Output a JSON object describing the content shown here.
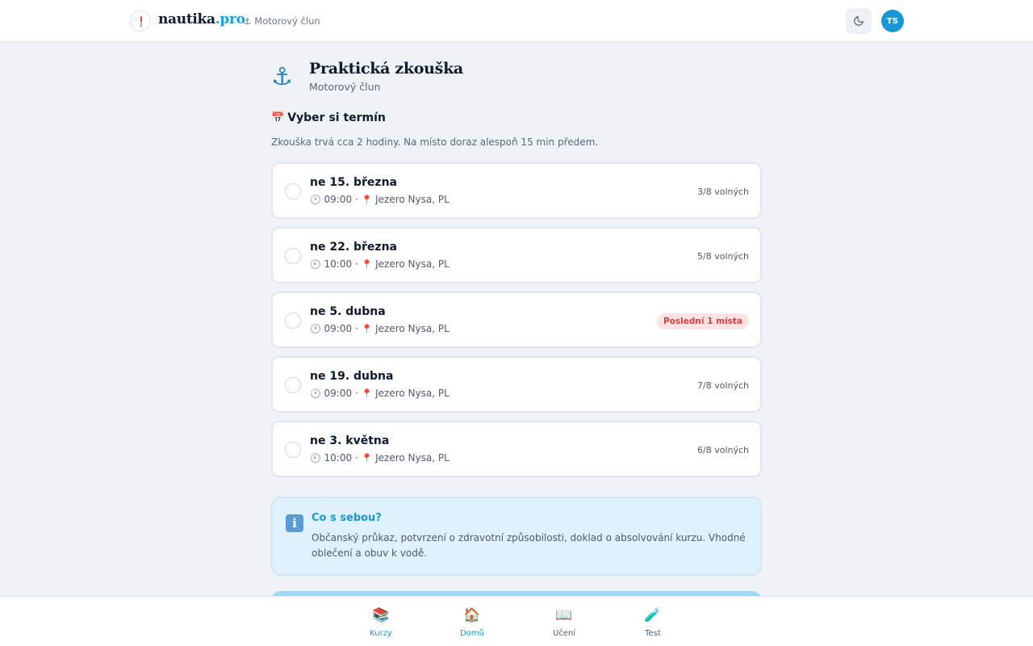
{
  "header": {
    "brand_main": "nautika",
    "brand_tld": ".pro",
    "breadcrumb": "· ⚓ Motorový člun",
    "avatar_initials": "TS",
    "theme_icon": "moon-icon"
  },
  "page": {
    "icon": "anchor-icon",
    "title": "Praktická zkouška",
    "subtitle": "Motorový člun",
    "section_icon": "📅",
    "section_title": "Vyber si termín",
    "intro": "Zkouška trvá cca 2 hodiny. Na místo doraz alespoň 15 min předem."
  },
  "slots": [
    {
      "date": "ne 15. března",
      "time": "09:00",
      "place": "Jezero Nysa, PL",
      "availability": "3/8 volných",
      "badge": ""
    },
    {
      "date": "ne 22. března",
      "time": "10:00",
      "place": "Jezero Nysa, PL",
      "availability": "5/8 volných",
      "badge": ""
    },
    {
      "date": "ne 5. dubna",
      "time": "09:00",
      "place": "Jezero Nysa, PL",
      "availability": "",
      "badge": "Poslední 1 místa"
    },
    {
      "date": "ne 19. dubna",
      "time": "09:00",
      "place": "Jezero Nysa, PL",
      "availability": "7/8 volných",
      "badge": ""
    },
    {
      "date": "ne 3. května",
      "time": "10:00",
      "place": "Jezero Nysa, PL",
      "availability": "6/8 volných",
      "badge": ""
    }
  ],
  "info": {
    "icon": "info-icon",
    "title": "Co s sebou?",
    "text": "Občanský průkaz, potvrzení o zdravotní způsobilosti, doklad o absolvování kurzu. Vhodné oblečení a obuv k vodě."
  },
  "nav": {
    "items": [
      {
        "label": "Kurzy",
        "icon": "📚",
        "active": true
      },
      {
        "label": "Domů",
        "icon": "🏠",
        "active": true
      },
      {
        "label": "Učení",
        "icon": "📖",
        "active": false
      },
      {
        "label": "Test",
        "icon": "🧪",
        "active": false
      }
    ]
  },
  "colors": {
    "accent": "#1a98d5",
    "background": "#eff3f8",
    "badge_bg": "#fde3e3",
    "badge_text": "#d8403d",
    "info_bg": "#dff1fc"
  }
}
